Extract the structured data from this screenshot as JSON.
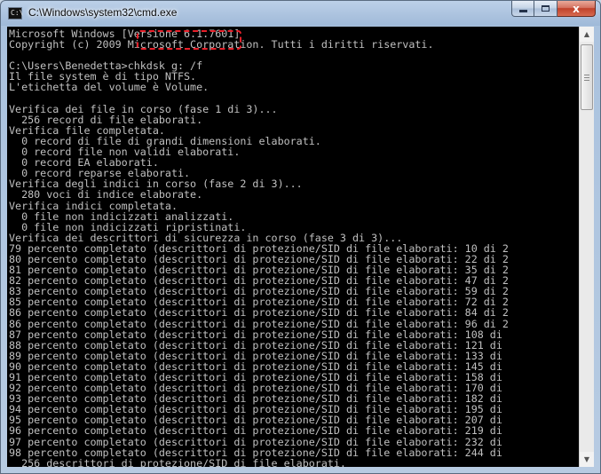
{
  "window": {
    "title": "C:\\Windows\\system32\\cmd.exe",
    "icon_label": "C:\\"
  },
  "controls": {
    "minimize": "minimize-icon",
    "maximize": "maximize-icon",
    "close_label": "x"
  },
  "console": {
    "lines": [
      "Microsoft Windows [Versione 6.1.7601]",
      "Copyright (c) 2009 Microsoft Corporation. Tutti i diritti riservati.",
      "",
      "C:\\Users\\Benedetta>chkdsk g: /f",
      "Il file system è di tipo NTFS.",
      "L'etichetta del volume è Volume.",
      "",
      "Verifica dei file in corso (fase 1 di 3)...",
      "  256 record di file elaborati.",
      "Verifica file completata.",
      "  0 record di file di grandi dimensioni elaborati.",
      "  0 record file non validi elaborati.",
      "  0 record EA elaborati.",
      "  0 record reparse elaborati.",
      "Verifica degli indici in corso (fase 2 di 3)...",
      "  280 voci di indice elaborate.",
      "Verifica indici completata.",
      "  0 file non indicizzati analizzati.",
      "  0 file non indicizzati ripristinati.",
      "Verifica dei descrittori di sicurezza in corso (fase 3 di 3)...",
      "79 percento completato (descrittori di protezione/SID di file elaborati: 10 di 2",
      "80 percento completato (descrittori di protezione/SID di file elaborati: 22 di 2",
      "81 percento completato (descrittori di protezione/SID di file elaborati: 35 di 2",
      "82 percento completato (descrittori di protezione/SID di file elaborati: 47 di 2",
      "83 percento completato (descrittori di protezione/SID di file elaborati: 59 di 2",
      "85 percento completato (descrittori di protezione/SID di file elaborati: 72 di 2",
      "86 percento completato (descrittori di protezione/SID di file elaborati: 84 di 2",
      "86 percento completato (descrittori di protezione/SID di file elaborati: 96 di 2",
      "87 percento completato (descrittori di protezione/SID di file elaborati: 108 di",
      "88 percento completato (descrittori di protezione/SID di file elaborati: 121 di",
      "89 percento completato (descrittori di protezione/SID di file elaborati: 133 di",
      "90 percento completato (descrittori di protezione/SID di file elaborati: 145 di",
      "91 percento completato (descrittori di protezione/SID di file elaborati: 158 di",
      "92 percento completato (descrittori di protezione/SID di file elaborati: 170 di",
      "93 percento completato (descrittori di protezione/SID di file elaborati: 182 di",
      "94 percento completato (descrittori di protezione/SID di file elaborati: 195 di",
      "95 percento completato (descrittori di protezione/SID di file elaborati: 207 di",
      "96 percento completato (descrittori di protezione/SID di file elaborati: 219 di",
      "97 percento completato (descrittori di protezione/SID di file elaborati: 232 di",
      "98 percento completato (descrittori di protezione/SID di file elaborati: 244 di",
      "  256 descrittori di protezione/SID di file elaborati."
    ],
    "text_color": "#c0c0c0",
    "background": "#000000"
  },
  "annotation": {
    "color": "#e8202a",
    "highlights": "chkdsk g: /f"
  }
}
